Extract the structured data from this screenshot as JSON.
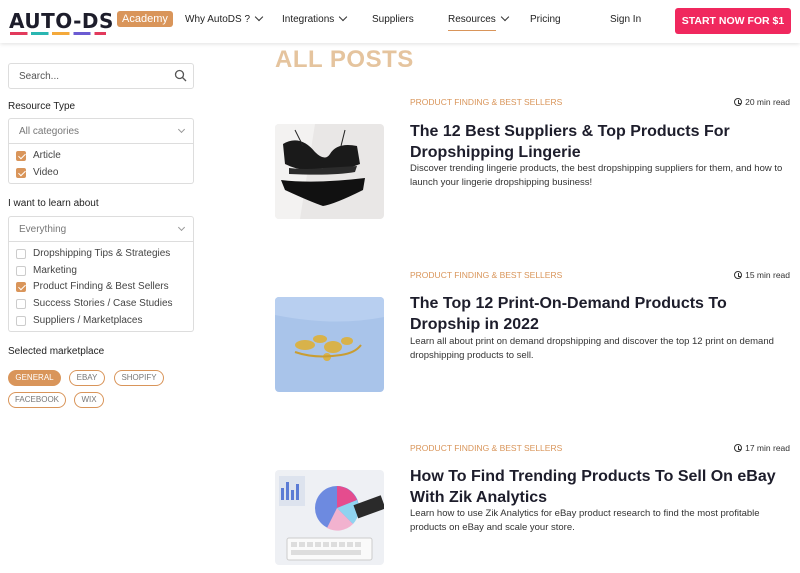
{
  "header": {
    "logo": "AUTO-DS",
    "academy_badge": "Academy",
    "nav": [
      {
        "label": "Why AutoDS ?",
        "has_dropdown": true
      },
      {
        "label": "Integrations",
        "has_dropdown": true
      },
      {
        "label": "Suppliers",
        "has_dropdown": false
      },
      {
        "label": "Resources",
        "has_dropdown": true,
        "active": true
      },
      {
        "label": "Pricing",
        "has_dropdown": false
      }
    ],
    "sign_in": "Sign In",
    "cta": "START NOW FOR $1"
  },
  "sidebar": {
    "search_placeholder": "Search...",
    "resource_type": {
      "label": "Resource Type",
      "select_value": "All categories",
      "options": [
        {
          "label": "Article",
          "checked": true
        },
        {
          "label": "Video",
          "checked": true
        }
      ]
    },
    "learn_about": {
      "label": "I want to learn about",
      "select_value": "Everything",
      "options": [
        {
          "label": "Dropshipping Tips & Strategies",
          "checked": false
        },
        {
          "label": "Marketing",
          "checked": false
        },
        {
          "label": "Product Finding & Best Sellers",
          "checked": true
        },
        {
          "label": "Success Stories / Case Studies",
          "checked": false
        },
        {
          "label": "Suppliers / Marketplaces",
          "checked": false
        }
      ]
    },
    "marketplace": {
      "label": "Selected marketplace",
      "chips": [
        {
          "label": "GENERAL",
          "active": true
        },
        {
          "label": "EBAY",
          "active": false
        },
        {
          "label": "SHOPIFY",
          "active": false
        },
        {
          "label": "FACEBOOK",
          "active": false
        },
        {
          "label": "WIX",
          "active": false
        }
      ]
    }
  },
  "main": {
    "heading": "ALL POSTS",
    "posts": [
      {
        "category": "PRODUCT FINDING & BEST SELLERS",
        "read_time": "20 min read",
        "title": "The 12 Best Suppliers & Top Products For Dropshipping Lingerie",
        "excerpt": "Discover trending lingerie products, the best dropshipping suppliers for them, and how to launch your lingerie dropshipping business!"
      },
      {
        "category": "PRODUCT FINDING & BEST SELLERS",
        "read_time": "15 min read",
        "title": "The Top 12 Print-On-Demand Products To Dropship in 2022",
        "excerpt": "Learn all about print on demand dropshipping and discover the top 12 print on demand dropshipping products to sell."
      },
      {
        "category": "PRODUCT FINDING & BEST SELLERS",
        "read_time": "17 min read",
        "title": "How To Find Trending Products To Sell On eBay With Zik Analytics",
        "excerpt": "Learn how to use Zik Analytics for eBay product research to find the most profitable products on eBay and scale your store."
      }
    ]
  },
  "colors": {
    "accent": "#d9955a",
    "cta": "#f0285e",
    "heading": "#e5c49e"
  }
}
